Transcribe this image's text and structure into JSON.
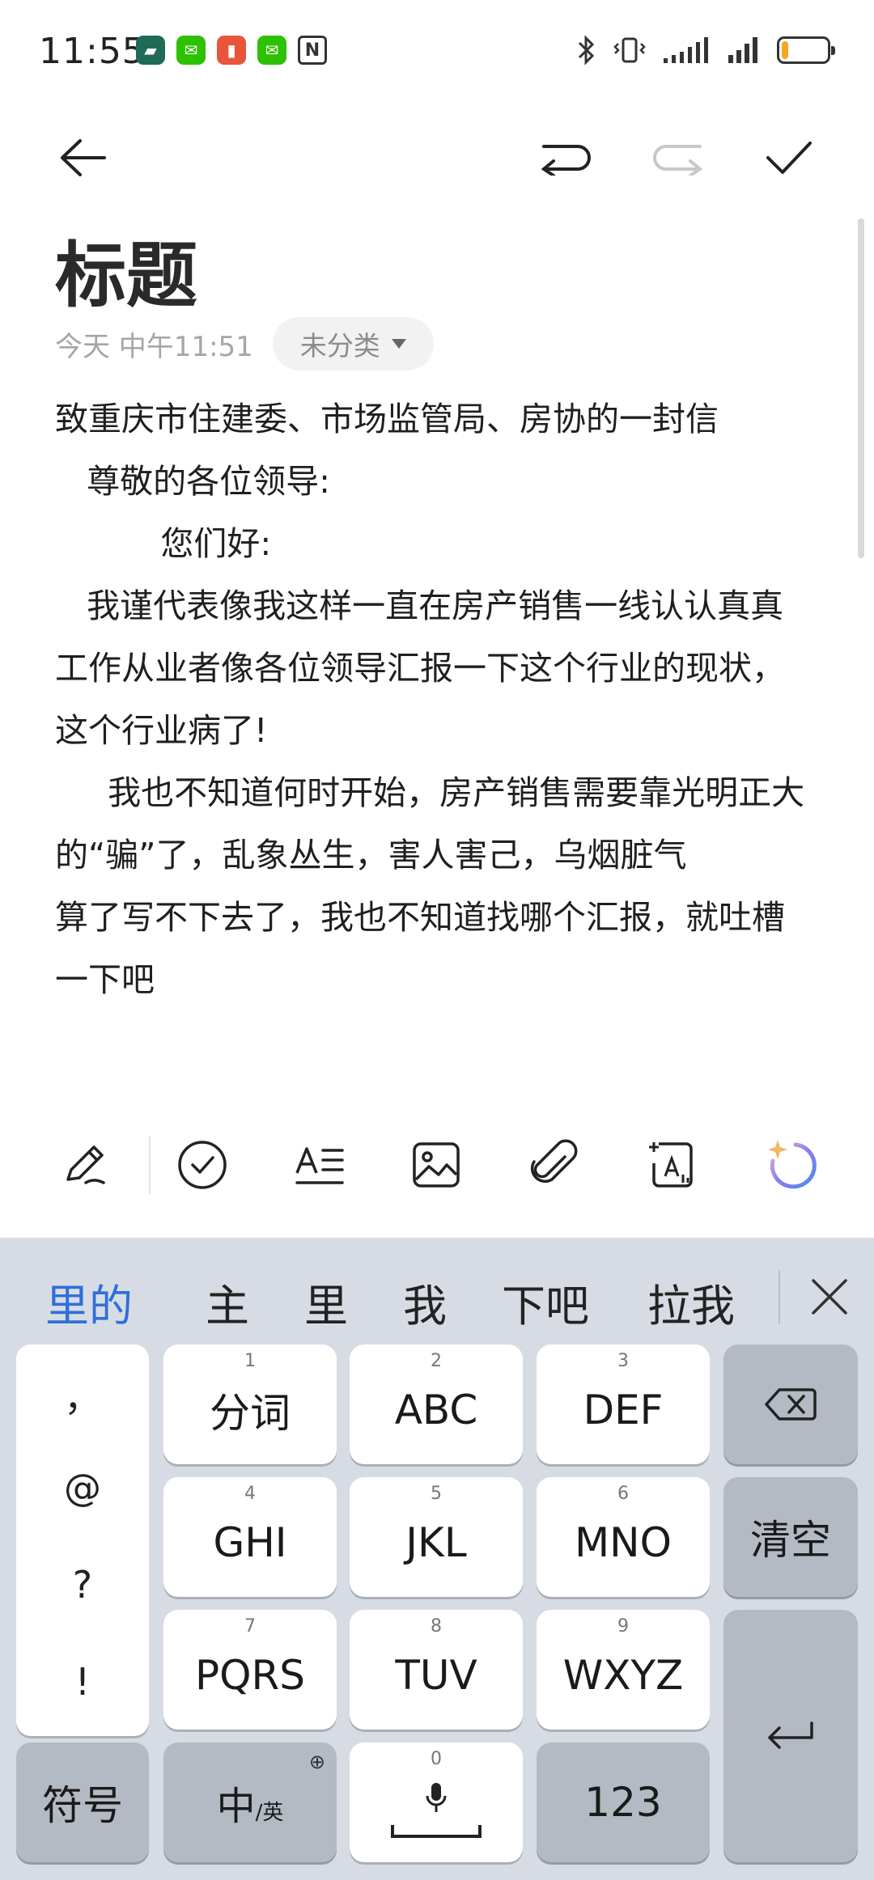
{
  "status_bar": {
    "time": "11:55",
    "battery_level": 0.15
  },
  "note": {
    "title": "标题",
    "date": "今天 中午11:51",
    "category": "未分类",
    "paragraphs": [
      "致重庆市住建委、市场监管局、房协的一封信",
      "   尊敬的各位领导:",
      "          您们好:",
      "   我谨代表像我这样一直在房产销售一线认认真真工作从业者像各位领导汇报一下这个行业的现状，这个行业病了!",
      "     我也不知道何时开始，房产销售需要靠光明正大的“骗”了，乱象丛生，害人害己，乌烟脏气",
      "算了写不下去了，我也不知道找哪个汇报，就吐槽一下吧"
    ]
  },
  "keyboard": {
    "candidates": [
      "里的",
      "主",
      "里",
      "我",
      "下吧",
      "拉我"
    ],
    "symbols": [
      "，",
      "@",
      "?",
      "!"
    ],
    "keys": {
      "k1_num": "1",
      "k1": "分词",
      "k2_num": "2",
      "k2": "ABC",
      "k3_num": "3",
      "k3": "DEF",
      "k4_num": "4",
      "k4": "GHI",
      "k5_num": "5",
      "k5": "JKL",
      "k6_num": "6",
      "k6": "MNO",
      "k7_num": "7",
      "k7": "PQRS",
      "k8_num": "8",
      "k8": "TUV",
      "k9_num": "9",
      "k9": "WXYZ",
      "k0_num": "0",
      "clear": "清空",
      "symbol": "符号",
      "lang_main": "中",
      "lang_sub": "/英",
      "numeric": "123"
    }
  },
  "colors": {
    "accent": "#2f6fdb",
    "keyboard_bg": "#d7dce4"
  }
}
